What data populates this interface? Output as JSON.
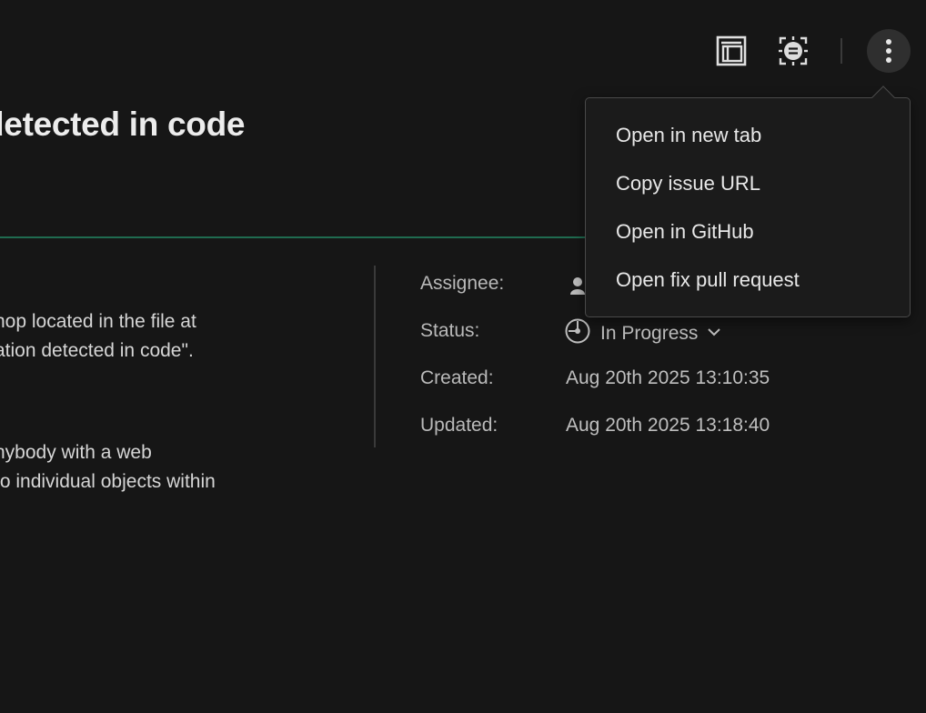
{
  "issue": {
    "title": "detected in code"
  },
  "description": {
    "paragraph1": [
      "hop located in the file at",
      "ation detected in code\"."
    ],
    "paragraph2": [
      "nybody with a web",
      "to individual objects within"
    ]
  },
  "toolbar": {
    "icons": [
      "panel-layout-icon",
      "ai-summary-icon",
      "more-vertical-icon"
    ]
  },
  "metadata": {
    "assignee_label": "Assignee:",
    "status_label": "Status:",
    "status_value": "In Progress",
    "created_label": "Created:",
    "created_value": "Aug 20th 2025 13:10:35",
    "updated_label": "Updated:",
    "updated_value": "Aug 20th 2025 13:18:40"
  },
  "menu": {
    "items": [
      "Open in new tab",
      "Copy issue URL",
      "Open in GitHub",
      "Open fix pull request"
    ]
  },
  "colors": {
    "background": "#161616",
    "accent_line": "#1f6b50",
    "menu_bg": "#1b1b1b"
  }
}
